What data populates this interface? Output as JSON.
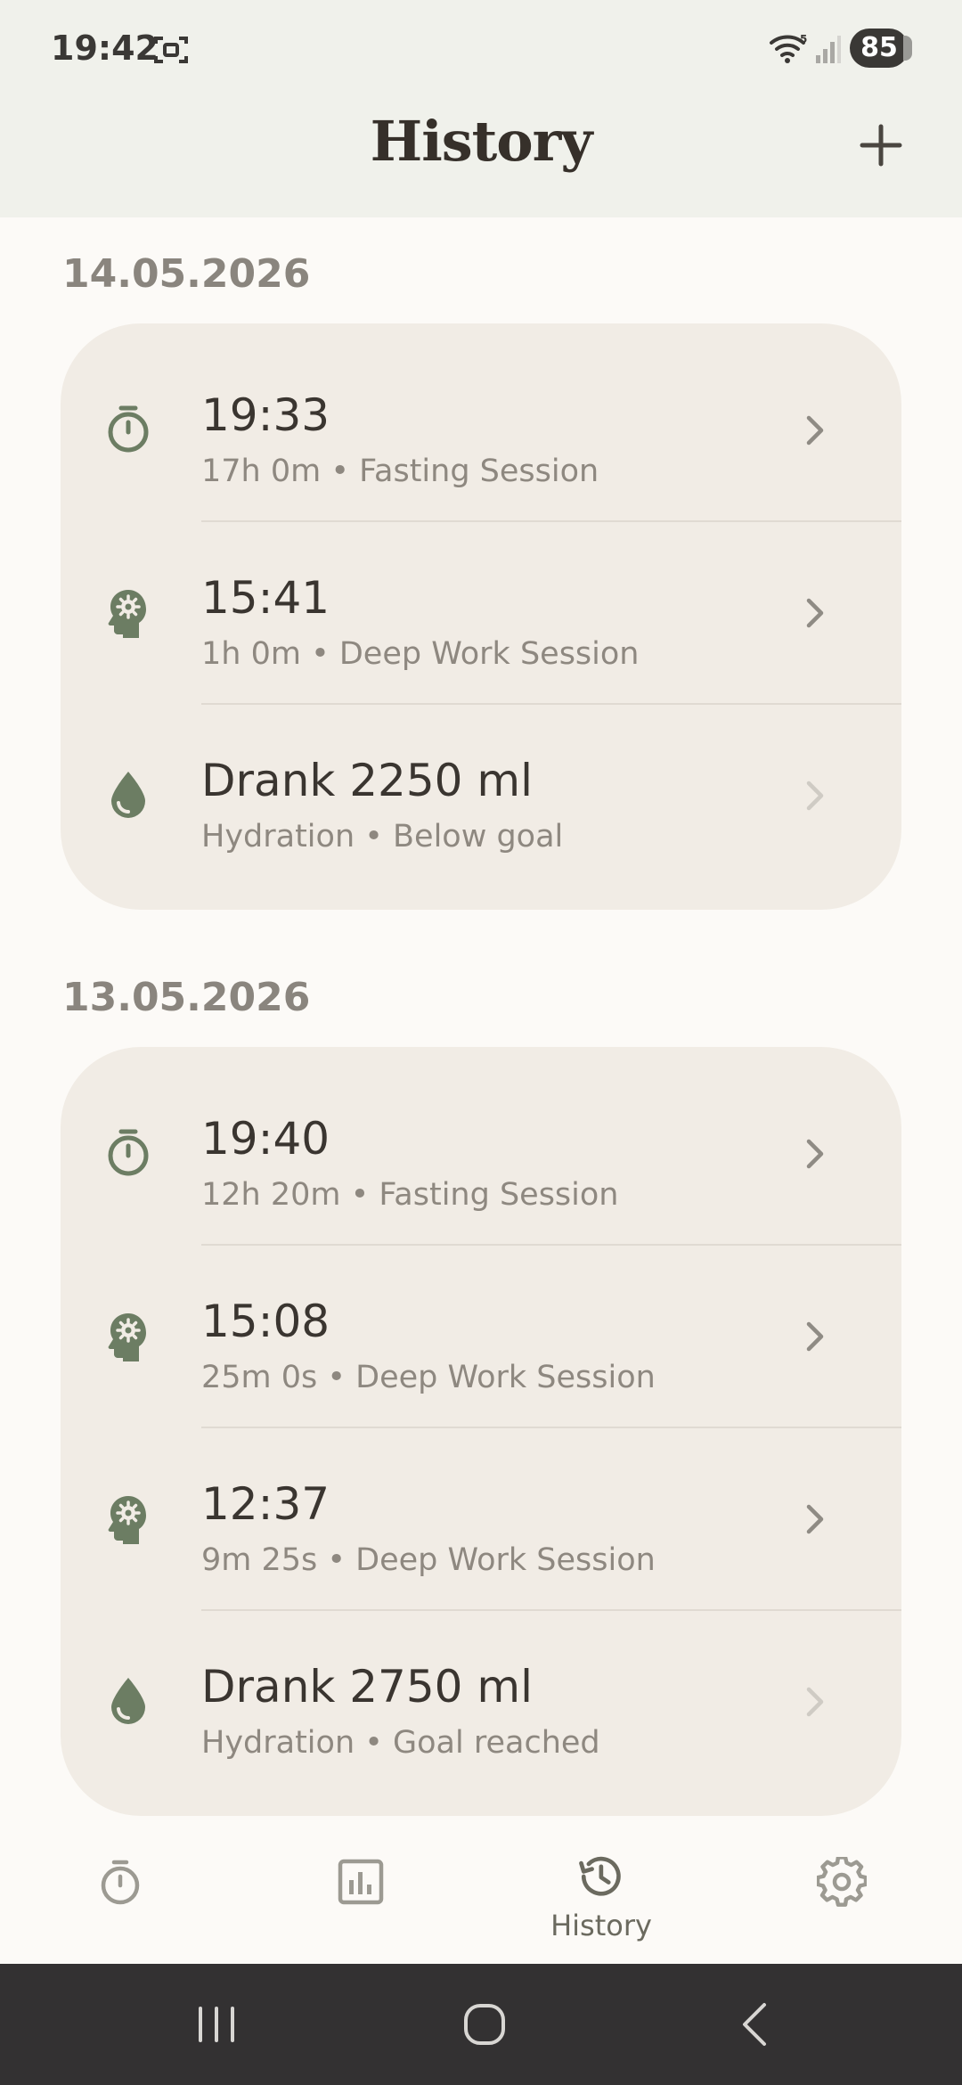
{
  "status_bar": {
    "time": "19:42",
    "battery": "85"
  },
  "header": {
    "title": "History",
    "add_icon": "plus-icon"
  },
  "sections": [
    {
      "date": "14.05.2026",
      "items": [
        {
          "icon": "stopwatch-icon",
          "title": "19:33",
          "subtitle": "17h 0m • Fasting Session",
          "chevron_dim": false
        },
        {
          "icon": "head-gear-icon",
          "title": "15:41",
          "subtitle": "1h 0m • Deep Work Session",
          "chevron_dim": false
        },
        {
          "icon": "water-drop-icon",
          "title": "Drank 2250 ml",
          "subtitle": "Hydration • Below goal",
          "chevron_dim": true
        }
      ]
    },
    {
      "date": "13.05.2026",
      "items": [
        {
          "icon": "stopwatch-icon",
          "title": "19:40",
          "subtitle": "12h 20m • Fasting Session",
          "chevron_dim": false
        },
        {
          "icon": "head-gear-icon",
          "title": "15:08",
          "subtitle": "25m 0s • Deep Work Session",
          "chevron_dim": false
        },
        {
          "icon": "head-gear-icon",
          "title": "12:37",
          "subtitle": "9m 25s • Deep Work Session",
          "chevron_dim": false
        },
        {
          "icon": "water-drop-icon",
          "title": "Drank 2750 ml",
          "subtitle": "Hydration • Goal reached",
          "chevron_dim": true
        }
      ]
    }
  ],
  "bottom_nav": {
    "items": [
      {
        "icon": "stopwatch-icon",
        "label": "",
        "active": false
      },
      {
        "icon": "bar-chart-icon",
        "label": "",
        "active": false
      },
      {
        "icon": "history-icon",
        "label": "History",
        "active": true
      },
      {
        "icon": "gear-icon",
        "label": "",
        "active": false
      }
    ]
  },
  "colors": {
    "accent": "#6c7d63",
    "header_bg": "#f0f1eb",
    "card_bg": "#f1ece5",
    "page_bg": "#fcfaf7",
    "system_bar": "#333132"
  }
}
